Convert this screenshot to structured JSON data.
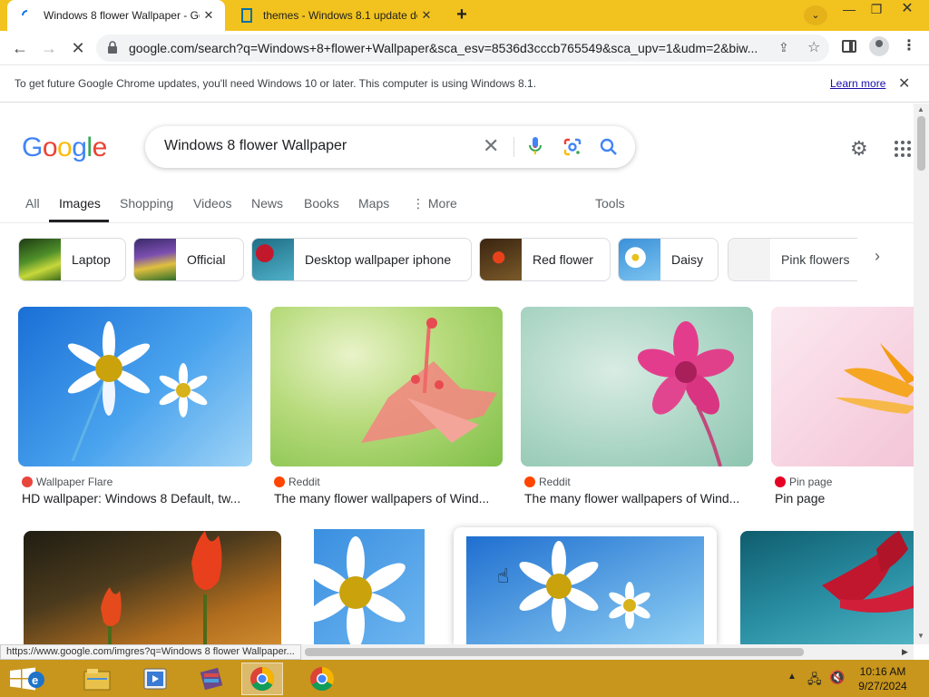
{
  "browser": {
    "tabs": [
      {
        "title": "Windows 8 flower Wallpaper - Goog",
        "close": "✕"
      },
      {
        "title": "themes - Windows 8.1 update delet",
        "close": "✕"
      }
    ],
    "new_tab": "+",
    "window_buttons": {
      "minimize": "—",
      "maximize": "❐",
      "close": "✕"
    },
    "url": "google.com/search?q=Windows+8+flower+Wallpaper&sca_esv=8536d3cccb765549&sca_upv=1&udm=2&biw...",
    "infobar": {
      "text": "To get future Google Chrome updates, you'll need Windows 10 or later. This computer is using Windows 8.1.",
      "link": "Learn more",
      "close": "✕"
    },
    "status_url": "https://www.google.com/imgres?q=Windows 8 flower Wallpaper..."
  },
  "search": {
    "logo": [
      "G",
      "o",
      "o",
      "g",
      "l",
      "e"
    ],
    "logo_colors": [
      "#4285f4",
      "#ea4335",
      "#fbbc05",
      "#4285f4",
      "#34a853",
      "#ea4335"
    ],
    "query": "Windows 8 flower Wallpaper",
    "tabs": [
      "All",
      "Images",
      "Shopping",
      "Videos",
      "News",
      "Books",
      "Maps",
      "⋮ More",
      "Tools"
    ],
    "active_tab": "Images",
    "chips": [
      "Laptop",
      "Official",
      "Desktop wallpaper iphone",
      "Red flower",
      "Daisy",
      "Pink flowers"
    ]
  },
  "results": [
    {
      "source": "Wallpaper Flare",
      "title": "HD wallpaper: Windows 8 Default, tw...",
      "source_color": "#e8453c"
    },
    {
      "source": "Reddit",
      "title": "The many flower wallpapers of Wind...",
      "source_color": "#ff4500"
    },
    {
      "source": "Reddit",
      "title": "The many flower wallpapers of Wind...",
      "source_color": "#ff4500"
    },
    {
      "source": "Pin page",
      "title": "Pin page",
      "source_color": "#e60023"
    }
  ],
  "taskbar": {
    "time": "10:16 AM",
    "date": "9/27/2024"
  }
}
